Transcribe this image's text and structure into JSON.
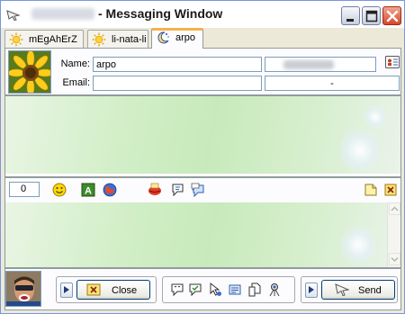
{
  "window": {
    "title": "- Messaging Window"
  },
  "tabs": [
    {
      "label": "mEgAhErZ",
      "active": false,
      "icon": "sun-icon"
    },
    {
      "label": "li-nata-li",
      "active": false,
      "icon": "sun-icon"
    },
    {
      "label": "arpo",
      "active": true,
      "icon": "moon-icon"
    }
  ],
  "contact": {
    "name_label": "Name:",
    "name_value": "arpo",
    "email_label": "Email:",
    "email_value": "",
    "status_value": "-"
  },
  "toolbar": {
    "char_count": "0",
    "icons": [
      "smiley-icon",
      "font-icon",
      "background-icon",
      "wink-kiss-icon",
      "nudge-icon",
      "voice-clip-icon",
      "note-icon",
      "close-small-icon"
    ]
  },
  "bottom": {
    "close_label": "Close",
    "send_label": "Send",
    "action_icons": [
      "quick-message-icon",
      "favorite-icon",
      "cursor-icon",
      "inbox-icon",
      "file-transfer-icon",
      "webcam-icon"
    ]
  },
  "colors": {
    "accent_tab": "#f5b04c",
    "border": "#919b9c",
    "close_button": "#d8462a"
  }
}
